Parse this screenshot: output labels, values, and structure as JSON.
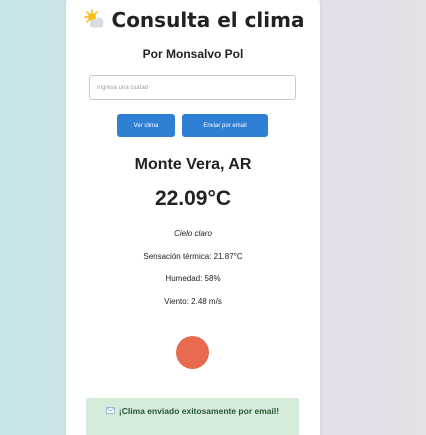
{
  "header": {
    "title": "Consulta el clima",
    "title_icon": "sun-behind-cloud-icon",
    "author": "Por Monsalvo Pol"
  },
  "search": {
    "placeholder": "Ingresa una ciudad",
    "value": ""
  },
  "buttons": {
    "weather_label": "Ver clima",
    "email_label": "Enviar por email"
  },
  "weather": {
    "location": "Monte Vera, AR",
    "temperature": "22.09°C",
    "description": "Cielo claro",
    "feels_like": "Sensación térmica: 21.87°C",
    "humidity": "Humedad: 58%",
    "wind": "Viento: 2.48 m/s"
  },
  "status": {
    "indicator_color": "#e86b4f"
  },
  "alert": {
    "icon": "email-icon",
    "message": "¡Clima enviado exitosamente por email!",
    "background_color": "#d6ecdb"
  },
  "colors": {
    "accent": "#2f7fd5",
    "background_left": "#c4e5e8",
    "background_right": "#e6e0e9"
  }
}
